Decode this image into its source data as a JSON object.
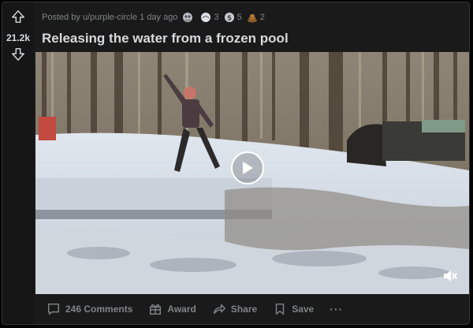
{
  "post": {
    "score": "21.2k",
    "meta": {
      "posted_by": "Posted by u/purple-circle 1 day ago",
      "awards": [
        {
          "icon": "silver-award-icon",
          "count": ""
        },
        {
          "icon": "helpful-award-icon",
          "count": "3"
        },
        {
          "icon": "coin-award-icon",
          "count": "5"
        },
        {
          "icon": "poop-award-icon",
          "count": "2"
        }
      ]
    },
    "title": "Releasing the water from a frozen pool",
    "media": {
      "type": "video",
      "play_icon": "play-icon",
      "mute_icon": "muted-speaker-icon"
    },
    "actions": {
      "comments": "246 Comments",
      "award": "Award",
      "share": "Share",
      "save": "Save",
      "more": "···"
    }
  },
  "colors": {
    "background": "#030303",
    "card": "#1a1a1b",
    "text": "#d7dadc",
    "muted": "#818384"
  }
}
